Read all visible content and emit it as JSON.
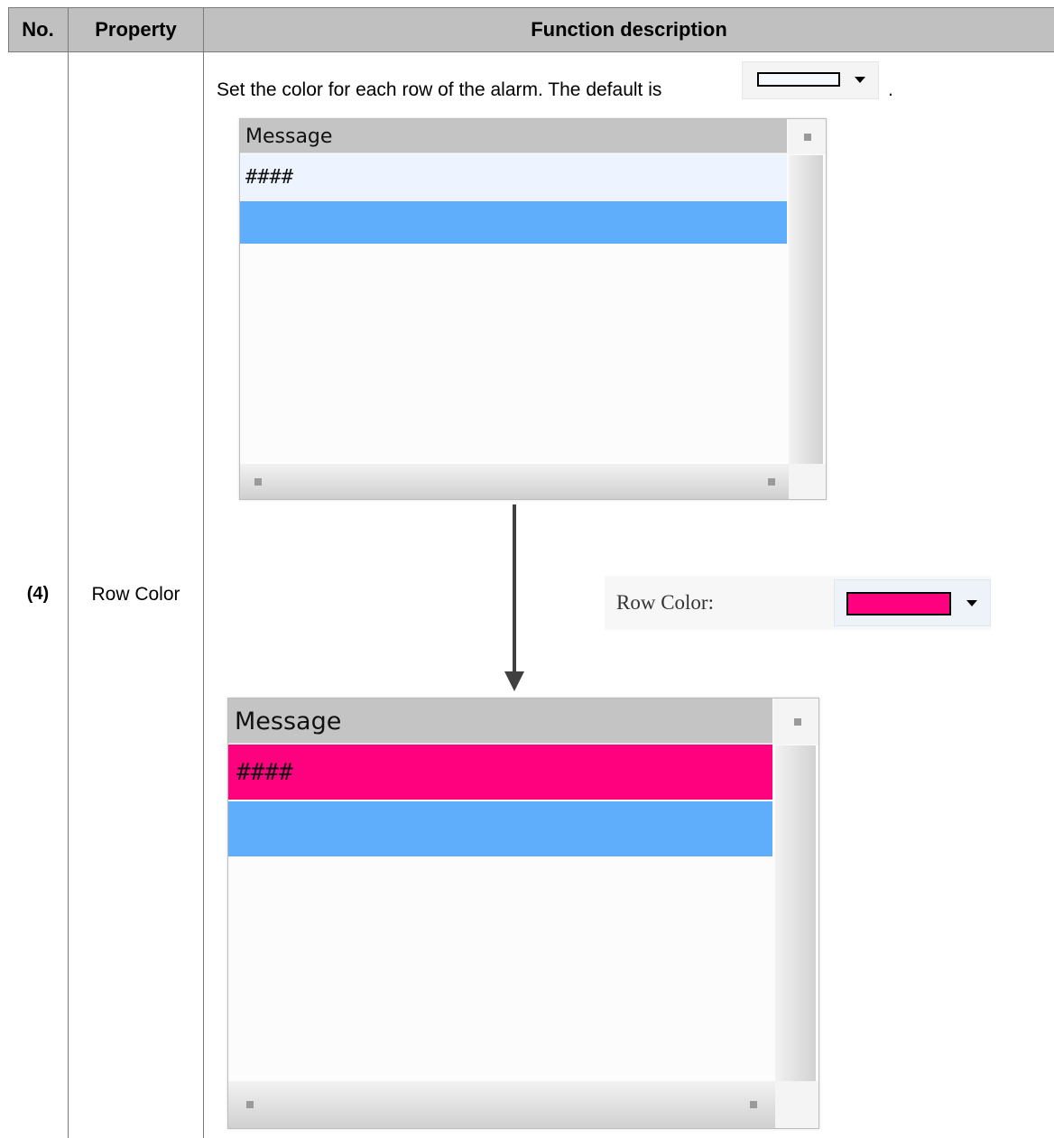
{
  "table": {
    "headers": {
      "no": "No.",
      "property": "Property",
      "description": "Function description"
    },
    "row": {
      "no": "(4)",
      "property": "Row Color",
      "description_text": "Set the color for each row of the alarm. The default is",
      "description_end": "."
    }
  },
  "default_color_combo": {
    "swatch_color": "#f6f9ff",
    "icon": "dropdown-caret"
  },
  "row_color_setting": {
    "label": "Row Color:",
    "swatch_color": "#ff007f",
    "icon": "dropdown-caret"
  },
  "alarm_before": {
    "header": "Message",
    "rows": [
      {
        "text": "####",
        "color": "#eef4ff"
      }
    ],
    "selected_row_color": "#5eaefb"
  },
  "alarm_after": {
    "header": "Message",
    "rows": [
      {
        "text": "####",
        "color": "#ff007f"
      }
    ],
    "selected_row_color": "#5eaefb"
  },
  "arrow": {
    "direction": "down"
  }
}
